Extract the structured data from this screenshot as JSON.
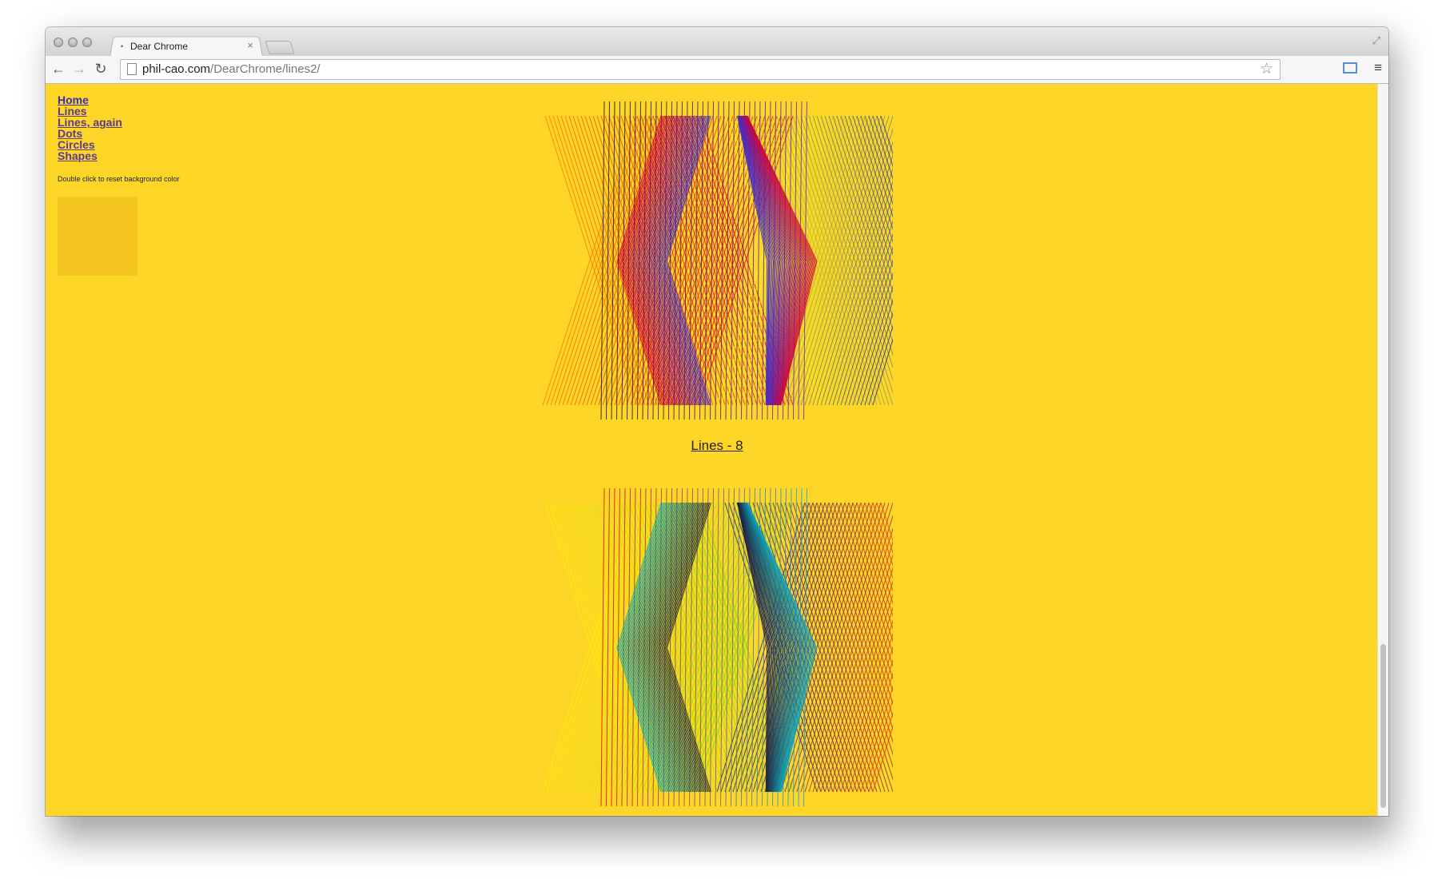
{
  "browser": {
    "tab_title": "Dear Chrome",
    "tab_close": "×",
    "url_domain": "phil-cao.com",
    "url_path": "/DearChrome/lines2/"
  },
  "nav": {
    "links": [
      "Home",
      "Lines",
      "Lines, again",
      "Dots",
      "Circles",
      "Shapes"
    ]
  },
  "hint_text": "Double click to reset background color",
  "page_background": "#fdd628",
  "swatch_color": "#f4c61f",
  "link_color": "#3a2fb0",
  "artworks": [
    {
      "caption": "Lines - 8",
      "layers": [
        {
          "shape": "x-left",
          "colors": [
            "#ff7a00",
            "#e8001c"
          ]
        },
        {
          "shape": "x-right",
          "colors": [
            "#ffff00",
            "#2233aa"
          ]
        },
        {
          "shape": "vertical",
          "colors": [
            "#1a1a1a",
            "#6a2bd0"
          ]
        },
        {
          "shape": "hex",
          "colors": [
            "#d4003a",
            "#3a2bd0"
          ]
        }
      ]
    },
    {
      "caption": "",
      "layers": [
        {
          "shape": "x-left",
          "colors": [
            "#ffee00",
            "#7adf00"
          ]
        },
        {
          "shape": "x-right",
          "colors": [
            "#1f2a80",
            "#ff3a00"
          ]
        },
        {
          "shape": "vertical",
          "colors": [
            "#e01010",
            "#20a0e0"
          ]
        },
        {
          "shape": "hex",
          "colors": [
            "#0aa8c0",
            "#1a1a40"
          ]
        }
      ]
    }
  ]
}
